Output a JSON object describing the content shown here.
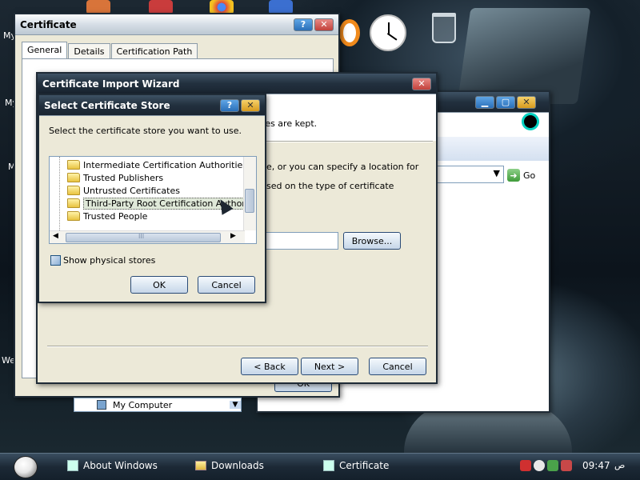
{
  "desktop": {
    "labels": [
      "My",
      "My",
      "M",
      "We"
    ]
  },
  "certificate_window": {
    "title": "Certificate",
    "help": "?",
    "close": "✕",
    "tabs": [
      "General",
      "Details",
      "Certification Path"
    ],
    "hidden_button": "OK"
  },
  "explorer_window": {
    "min": "▁",
    "max": "▢",
    "close": "✕",
    "go_label": "Go",
    "bottom_label": "My Computer"
  },
  "wizard_window": {
    "title": "Certificate Import Wizard",
    "close": "✕",
    "text_line1": "tes are kept.",
    "text_line2": "e, or you can specify a location for",
    "text_line3": "sed on the type of certificate",
    "browse_label": "Browse...",
    "back_label": "< Back",
    "next_label": "Next >",
    "cancel_label": "Cancel"
  },
  "select_store": {
    "title": "Select Certificate Store",
    "help": "?",
    "close": "✕",
    "prompt": "Select the certificate store you want to use.",
    "items": [
      "Intermediate Certification Authorities",
      "Trusted Publishers",
      "Untrusted Certificates",
      "Third-Party Root Certification Authorities",
      "Trusted People"
    ],
    "selected_index": 3,
    "show_physical_label": "Show physical stores",
    "ok_label": "OK",
    "cancel_label": "Cancel",
    "hscroll_grip": "III"
  },
  "taskbar": {
    "items": [
      {
        "label": "About Windows"
      },
      {
        "label": "Downloads"
      },
      {
        "label": "Certificate"
      }
    ],
    "clock": "09:47",
    "clock_suffix": "ص"
  }
}
